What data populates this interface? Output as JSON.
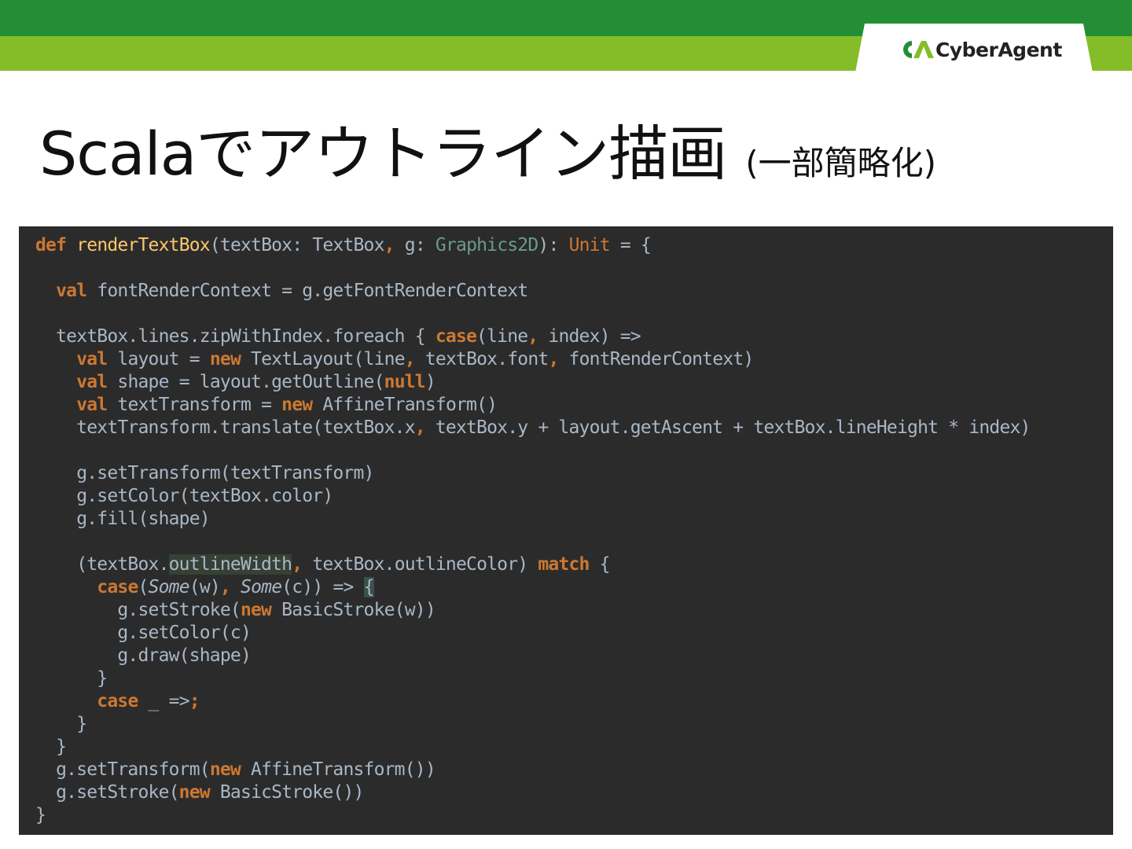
{
  "header": {
    "brand_name": "CyberAgent",
    "brand_mark": "CA",
    "colors": {
      "dark_green": "#238e35",
      "light_green": "#84bd27"
    }
  },
  "slide": {
    "title": "Scalaでアウトライン描画",
    "subtitle": "(一部簡略化)"
  },
  "code": {
    "language": "scala",
    "lines": [
      "def renderTextBox(textBox: TextBox, g: Graphics2D): Unit = {",
      "",
      "  val fontRenderContext = g.getFontRenderContext",
      "",
      "  textBox.lines.zipWithIndex.foreach { case(line, index) =>",
      "    val layout = new TextLayout(line, textBox.font, fontRenderContext)",
      "    val shape = layout.getOutline(null)",
      "    val textTransform = new AffineTransform()",
      "    textTransform.translate(textBox.x, textBox.y + layout.getAscent + textBox.lineHeight * index)",
      "",
      "    g.setTransform(textTransform)",
      "    g.setColor(textBox.color)",
      "    g.fill(shape)",
      "",
      "    (textBox.outlineWidth, textBox.outlineColor) match {",
      "      case(Some(w), Some(c)) => {",
      "        g.setStroke(new BasicStroke(w))",
      "        g.setColor(c)",
      "        g.draw(shape)",
      "      }",
      "      case _ =>;",
      "    }",
      "  }",
      "  g.setTransform(new AffineTransform())",
      "  g.setStroke(new BasicStroke())",
      "}"
    ]
  }
}
